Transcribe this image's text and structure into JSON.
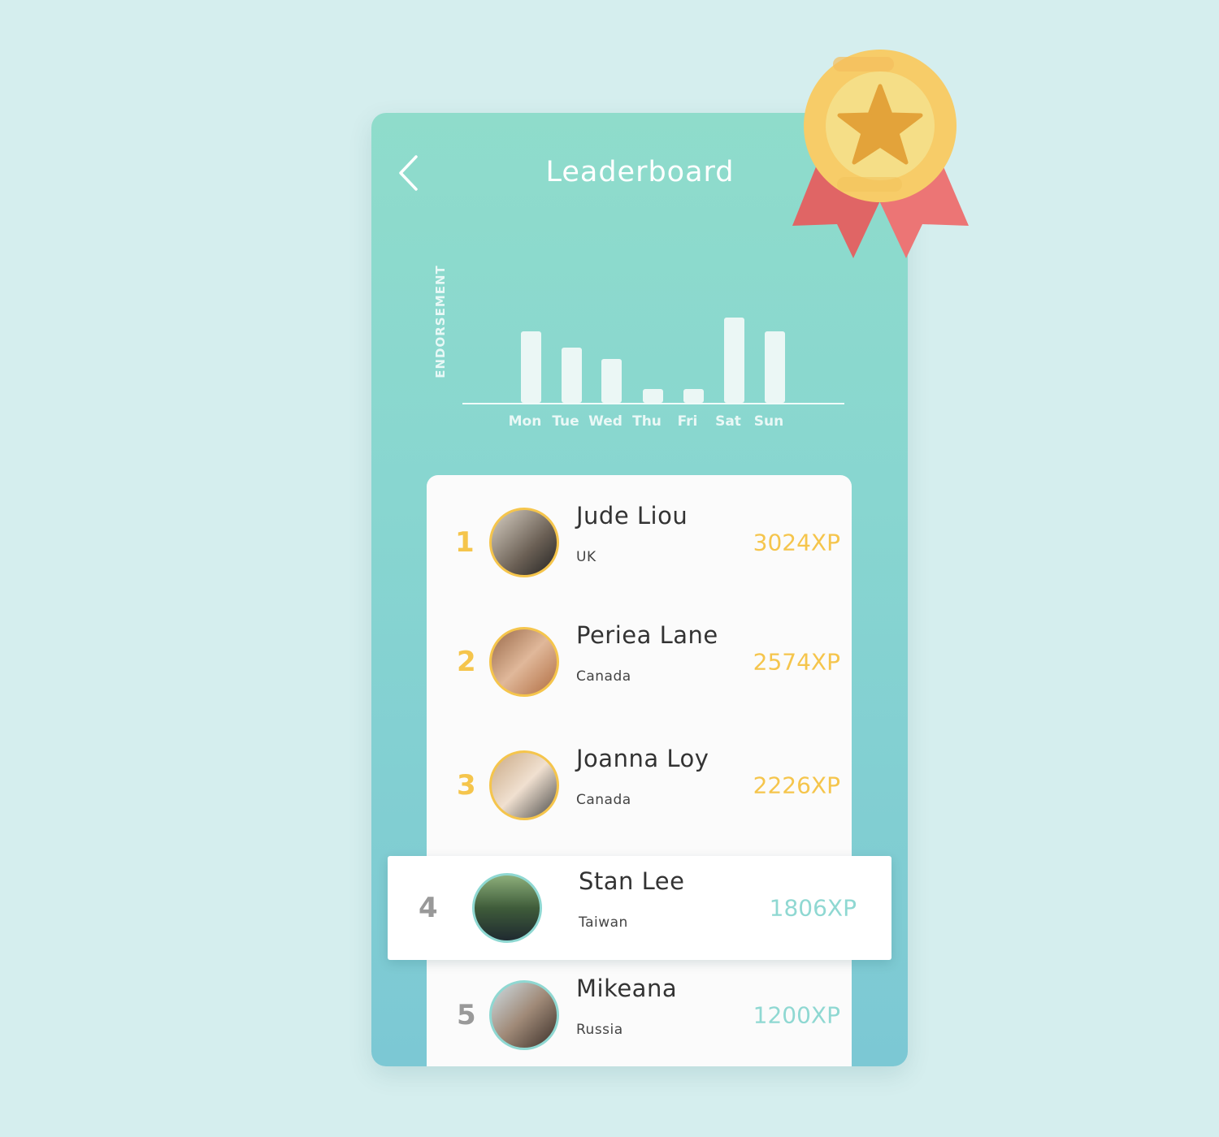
{
  "header": {
    "title": "Leaderboard",
    "back_icon": "chevron-left-icon"
  },
  "medal_icon": "medal-star-icon",
  "colors": {
    "gold": "#f5c54c",
    "teal": "#8fd8d2",
    "rank_gray": "#999999"
  },
  "chart_data": {
    "type": "bar",
    "ylabel": "ENDORSEMENT",
    "categories": [
      "Mon",
      "Tue",
      "Wed",
      "Thu",
      "Fri",
      "Sat",
      "Sun"
    ],
    "values": [
      88,
      68,
      54,
      17,
      17,
      105,
      88
    ],
    "grid": false
  },
  "leaderboard": [
    {
      "rank": "1",
      "name": "Jude Liou",
      "country": "UK",
      "xp": "3024XP"
    },
    {
      "rank": "2",
      "name": "Periea Lane",
      "country": "Canada",
      "xp": "2574XP"
    },
    {
      "rank": "3",
      "name": "Joanna Loy",
      "country": "Canada",
      "xp": "2226XP"
    },
    {
      "rank": "4",
      "name": "Stan Lee",
      "country": "Taiwan",
      "xp": "1806XP"
    },
    {
      "rank": "5",
      "name": "Mikeana",
      "country": "Russia",
      "xp": "1200XP"
    }
  ]
}
